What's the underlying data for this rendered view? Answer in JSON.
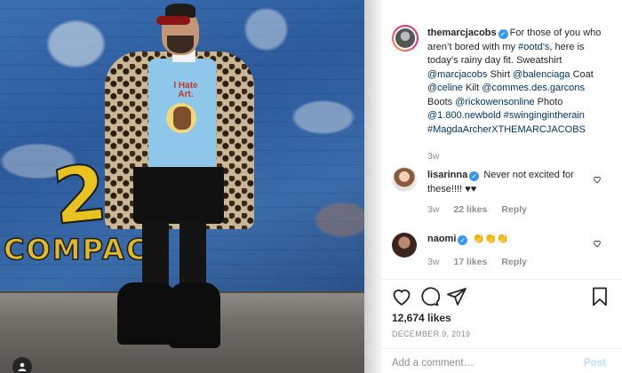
{
  "post": {
    "author": "themarcjacobs",
    "caption_text": "For those of you who aren’t bored with my ",
    "caption_hashtag_ootd": "#ootd’s",
    "caption_mid": ", here is today’s rainy day fit. Sweatshirt ",
    "caption_mention_marcjacobs": "@marcjacobs",
    "caption_shirt": " Shirt ",
    "caption_mention_balenciaga": "@balenciaga",
    "caption_coat": " Coat ",
    "caption_mention_celine": "@celine",
    "caption_kilt": " Kilt ",
    "caption_mention_cdg": "@commes.des.garcons",
    "caption_boots": " Boots ",
    "caption_mention_rickowens": "@rickowensonline",
    "caption_photo": " Photo ",
    "caption_mention_newbold": "@1.800.newbold",
    "caption_hashtag_rain": "#swingingintherain",
    "caption_hashtag_magda": "#MagdaArcherXTHEMARCJACOBS",
    "time_ago": "3w"
  },
  "photo": {
    "sweatshirt_text": "I Hate Art.",
    "graffiti_number": "2",
    "graffiti_word": "COMPACT"
  },
  "comments": [
    {
      "user": "lisarinna",
      "text": "Never not excited for these!!!! ♥♥",
      "time": "3w",
      "likes": "22 likes",
      "reply": "Reply"
    },
    {
      "user": "naomi",
      "text": "👏👏👏",
      "time": "3w",
      "likes": "17 likes",
      "reply": "Reply"
    }
  ],
  "likes_count": "12,674 likes",
  "date": "DECEMBER 9, 2019",
  "add_comment": {
    "placeholder": "Add a comment…",
    "post_label": "Post"
  },
  "icons": [
    "heart-icon",
    "comment-icon",
    "share-icon",
    "bookmark-icon",
    "user-tag-icon",
    "verified-badge-icon"
  ],
  "colors": {
    "link": "#003569",
    "verified": "#3897f0",
    "muted": "#8e8e8e",
    "post_disabled": "#b9dcfb"
  }
}
